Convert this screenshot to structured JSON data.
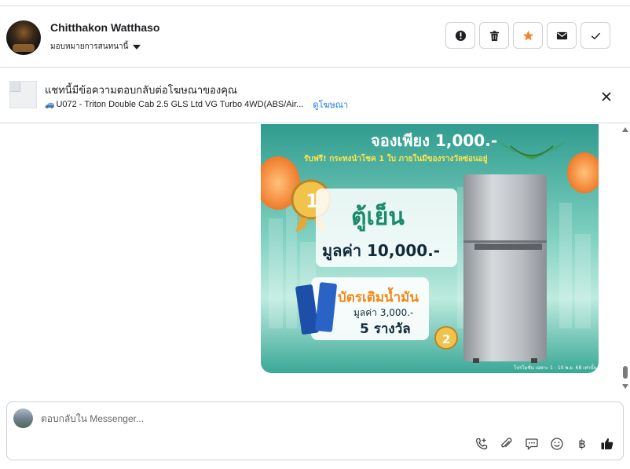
{
  "header": {
    "contact_name": "Chitthakon Watthaso",
    "assign_label": "มอบหมายการสนทนานี้",
    "actions": [
      {
        "name": "mark-spam-button",
        "icon": "alert-circle-icon"
      },
      {
        "name": "delete-button",
        "icon": "trash-icon"
      },
      {
        "name": "star-button",
        "icon": "star-icon"
      },
      {
        "name": "mark-unread-button",
        "icon": "envelope-icon"
      },
      {
        "name": "mark-done-button",
        "icon": "check-icon"
      }
    ]
  },
  "ad_banner": {
    "title": "แชทนี้มีข้อความตอบกลับต่อโฆษณาของคุณ",
    "ad_name": "U072 - Triton Double Cab 2.5 GLS Ltd VG Turbo 4WD(ABS/Air...",
    "view_ad_link": "ดูโฆษณา"
  },
  "ad_image": {
    "line1": "จองเพียง 1,000.-",
    "line2": "รับฟรี! กระทงนำโชค 1 ใบ ภายในมีของรางวัลซ่อนอยู่",
    "prize1_rank": "1",
    "prize1_name": "ตู้เย็น",
    "prize1_value": "มูลค่า 10,000.-",
    "prize2_rank": "2",
    "prize2_name": "บัตรเติมน้ำมัน",
    "prize2_value": "มูลค่า 3,000.-",
    "prize2_count": "5 รางวัล",
    "fine_print": "โปรโมชั่น เฉพาะ 1 - 10 พ.ย. 68 เท่านั้น"
  },
  "composer": {
    "placeholder": "ตอบกลับใน Messenger..."
  },
  "colors": {
    "star": "#f5822a",
    "link": "#1877f2",
    "like": "#1c1e21"
  }
}
